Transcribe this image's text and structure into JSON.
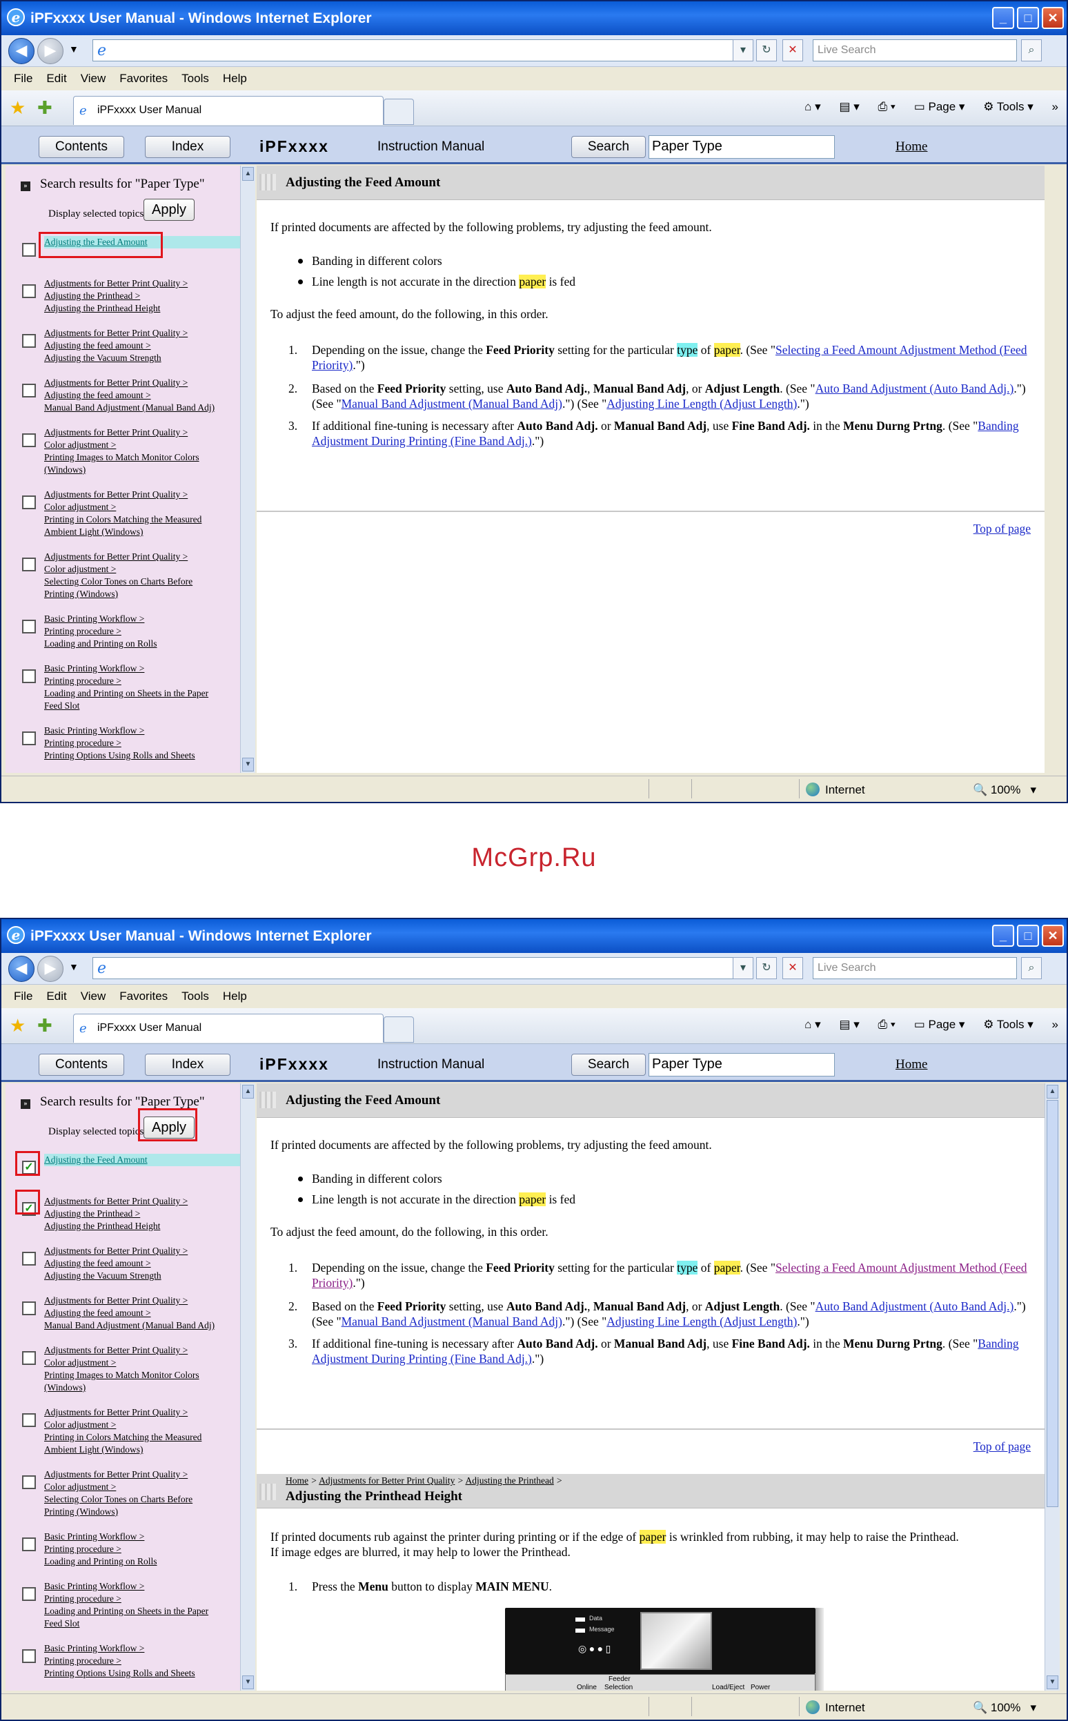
{
  "watermark": "McGrp.Ru",
  "window": {
    "title": "iPFxxxx User Manual - Windows Internet Explorer",
    "minimize": "_",
    "maximize": "□",
    "close": "✕"
  },
  "addressbar": {
    "back_icon": "back-arrow-icon",
    "forward_icon": "forward-arrow-icon",
    "search_placeholder": "Live Search",
    "refresh": "↻",
    "stop": "✕",
    "search_go": "⌕"
  },
  "menu": [
    "File",
    "Edit",
    "View",
    "Favorites",
    "Tools",
    "Help"
  ],
  "tab": {
    "label": "iPFxxxx User Manual"
  },
  "toolbar": {
    "page": "Page",
    "tools": "Tools"
  },
  "header": {
    "contents": "Contents",
    "index": "Index",
    "brand": "iPFxxxx",
    "subtitle": "Instruction Manual",
    "search": "Search",
    "keyword": "Paper Type",
    "home": "Home"
  },
  "sidebar": {
    "search_results": "Search results for \"Paper Type\"",
    "display_selected": "Display selected topics",
    "apply": "Apply",
    "items": [
      {
        "lines": [
          "Adjusting the Feed Amount"
        ]
      },
      {
        "lines": [
          "Adjustments for Better Print Quality >",
          "Adjusting the Printhead >",
          "Adjusting the Printhead Height"
        ]
      },
      {
        "lines": [
          "Adjustments for Better Print Quality >",
          "Adjusting the feed amount >",
          "Adjusting the Vacuum Strength"
        ]
      },
      {
        "lines": [
          "Adjustments for Better Print Quality >",
          "Adjusting the feed amount >",
          "Manual Band Adjustment (Manual Band Adj)"
        ]
      },
      {
        "lines": [
          "Adjustments for Better Print Quality >",
          "Color adjustment >",
          "Printing Images to Match Monitor Colors",
          "(Windows)"
        ]
      },
      {
        "lines": [
          "Adjustments for Better Print Quality >",
          "Color adjustment >",
          "Printing in Colors Matching the Measured",
          "Ambient Light (Windows)"
        ]
      },
      {
        "lines": [
          "Adjustments for Better Print Quality >",
          "Color adjustment >",
          "Selecting Color Tones on Charts Before",
          "Printing (Windows)"
        ]
      },
      {
        "lines": [
          "Basic Printing Workflow >",
          "Printing procedure >",
          "Loading and Printing on Rolls"
        ]
      },
      {
        "lines": [
          "Basic Printing Workflow >",
          "Printing procedure >",
          "Loading and Printing on Sheets in the Paper",
          "Feed Slot"
        ]
      },
      {
        "lines": [
          "Basic Printing Workflow >",
          "Printing procedure >",
          "Printing Options Using Rolls and Sheets"
        ]
      }
    ]
  },
  "topic1": {
    "title": "Adjusting the Feed Amount",
    "intro": "If printed documents are affected by the following problems, try adjusting the feed amount.",
    "bullet1": "Banding in different colors",
    "bullet2_a": "Line length is not accurate in the direction ",
    "bullet2_hl": "paper",
    "bullet2_b": " is fed",
    "order": "To adjust the feed amount, do the following, in this order.",
    "s1_a": "Depending on the issue, change the ",
    "s1_b": "Feed Priority",
    "s1_c": " setting for the particular ",
    "s1_type": "type",
    "s1_of": " of ",
    "s1_paper": "paper",
    "s1_d": ".  (See \"",
    "s1_link": "Selecting a Feed Amount Adjustment Method (Feed Priority)",
    "s1_e": ".\")",
    "s2_a": "Based on the ",
    "s2_b": "Feed Priority",
    "s2_c": " setting, use ",
    "s2_d": "Auto Band Adj.",
    "s2_e": ", ",
    "s2_f": "Manual Band Adj",
    "s2_g": ", or ",
    "s2_h": "Adjust Length",
    "s2_i": ".  (See \"",
    "s2_link1": "Auto Band Adjustment (Auto Band Adj.)",
    "s2_j": ".\") (See \"",
    "s2_link2": "Manual Band Adjustment (Manual Band Adj)",
    "s2_k": ".\") (See \"",
    "s2_link3": "Adjusting Line Length (Adjust Length)",
    "s2_l": ".\")",
    "s3_a": "If additional fine-tuning is necessary after ",
    "s3_b": "Auto Band Adj.",
    "s3_c": " or ",
    "s3_d": "Manual Band Adj",
    "s3_e": ", use ",
    "s3_f": "Fine Band Adj.",
    "s3_g": " in the ",
    "s3_h": "Menu Durng Prtng",
    "s3_i": ".  (See \"",
    "s3_link": "Banding Adjustment During Printing (Fine Band Adj.)",
    "s3_j": ".\")",
    "n1": "1.",
    "n2": "2.",
    "n3": "3.",
    "top_of_page": "Top of page"
  },
  "topic2": {
    "breadcrumb": [
      "Home",
      "Adjustments for Better Print Quality",
      "Adjusting the Printhead"
    ],
    "sep": ">",
    "title": "Adjusting the Printhead Height",
    "p1_a": "If printed documents rub against the printer during printing or if the edge of ",
    "p1_hl": "paper",
    "p1_b": " is wrinkled from rubbing, it may help to raise the Printhead.",
    "p2": "If image edges are blurred, it may help to lower the Printhead.",
    "s1_a": "Press the ",
    "s1_b": "Menu",
    "s1_c": " button to display ",
    "s1_d": "MAIN MENU",
    "s1_e": ".",
    "n1": "1.",
    "panel": {
      "data": "Data",
      "message": "Message",
      "feeder": "Feeder",
      "selection": "Selection",
      "online": "Online",
      "loadeject": "Load/Eject",
      "power": "Power"
    }
  },
  "status": {
    "zone": "Internet",
    "zoom": "100%"
  }
}
